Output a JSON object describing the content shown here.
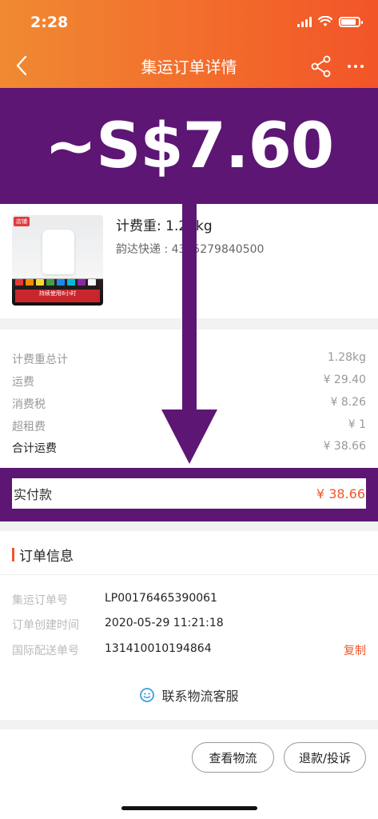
{
  "status_bar": {
    "time": "2:28"
  },
  "nav": {
    "title": "集运订单详情"
  },
  "banner": {
    "price": "~S$7.60"
  },
  "product": {
    "thumb_tag": "店铺",
    "thumb_caption": "持续使用8小时",
    "weight": "计费重: 1.28kg",
    "courier": "韵达快递 : 4315279840500"
  },
  "fees": [
    {
      "label": "计费重总计",
      "value": "1.28kg"
    },
    {
      "label": "运费",
      "value": "¥ 29.40"
    },
    {
      "label": "消费税",
      "value": "¥ 8.26"
    },
    {
      "label": "超租费",
      "value": "¥ 1"
    },
    {
      "label": "合计运费",
      "value": "¥ 38.66"
    }
  ],
  "paid": {
    "label": "实付款",
    "value": "¥ 38.66"
  },
  "order_info": {
    "title": "订单信息",
    "rows": [
      {
        "label": "集运订单号",
        "value": "LP00176465390061"
      },
      {
        "label": "订单创建时间",
        "value": "2020-05-29 11:21:18"
      },
      {
        "label": "国际配送单号",
        "value": "131410010194864"
      }
    ],
    "copy_label": "复制",
    "service_label": "联系物流客服"
  },
  "actions": {
    "logistics": "查看物流",
    "refund": "退款/投诉"
  },
  "colors": {
    "accent": "#f2562a",
    "overlay": "#5d1673"
  }
}
